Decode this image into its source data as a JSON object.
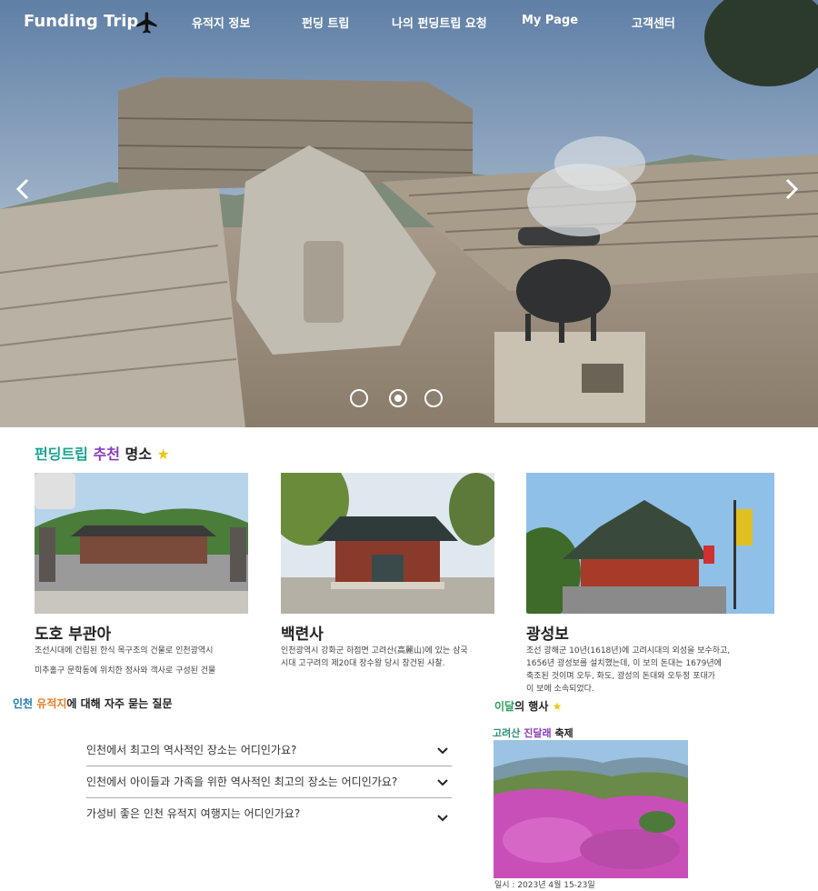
{
  "header": {
    "brand": "Funding Trip",
    "brand_icon": "airplane-icon",
    "nav": [
      "유적지 정보",
      "펀딩 트립",
      "나의 펀딩트립 요청",
      "My Page",
      "고객센터"
    ]
  },
  "hero": {
    "prev_icon": "chevron-left-icon",
    "next_icon": "chevron-right-icon",
    "slides": 3,
    "active_slide": 2
  },
  "recommend": {
    "title_part1": "펀딩트립",
    "title_part2": "추천",
    "title_part3": "명소",
    "star": "★",
    "cards": [
      {
        "title": "도호 부관아",
        "desc": [
          "조선시대에 건립된 한식 목구조의 건물로 인천광역시",
          "미추홀구 문학동에 위치한 정사와 객사로 구성된 건물"
        ]
      },
      {
        "title": "백련사",
        "desc": [
          "인천광역시 강화군 하점면 고려산(高麗山)에 있는 삼국",
          "시대 고구려의 제20대 장수왕 당시 창건된 사찰."
        ]
      },
      {
        "title": "광성보",
        "desc": [
          "조선 광해군 10년(1618년)에 고려시대의 외성을 보수하고,",
          "1656년 광성보를 설치했는데, 이 보의 돈대는 1679년에",
          "축조된 것이며 오두, 화도, 광성의 돈대와 오두정 포대가",
          "이 보에 소속되었다."
        ]
      }
    ]
  },
  "faq": {
    "title_part1": "인천",
    "title_part2": "유적지",
    "title_part3": "에 대해 자주 묻는 질문",
    "items": [
      "인천에서 최고의 역사적인 장소는 어디인가요?",
      "인천에서 아이들과 가족을 위한 역사적인 최고의 장소는 어디인가요?",
      "가성비 좋은 인천 유적지 여행지는 어디인가요?"
    ]
  },
  "event": {
    "title_part1": "이달",
    "title_part2": "의 행사",
    "star": "★",
    "name_part1": "고려산",
    "name_part2": "진달래",
    "name_part3": "축제",
    "date": "일시 : 2023년 4월 15-23일"
  },
  "colors": {
    "teal": "#1aa38f",
    "purple": "#8a3ab9",
    "blue": "#1f77b4",
    "orange": "#e67e22",
    "star": "#f1c40f"
  }
}
